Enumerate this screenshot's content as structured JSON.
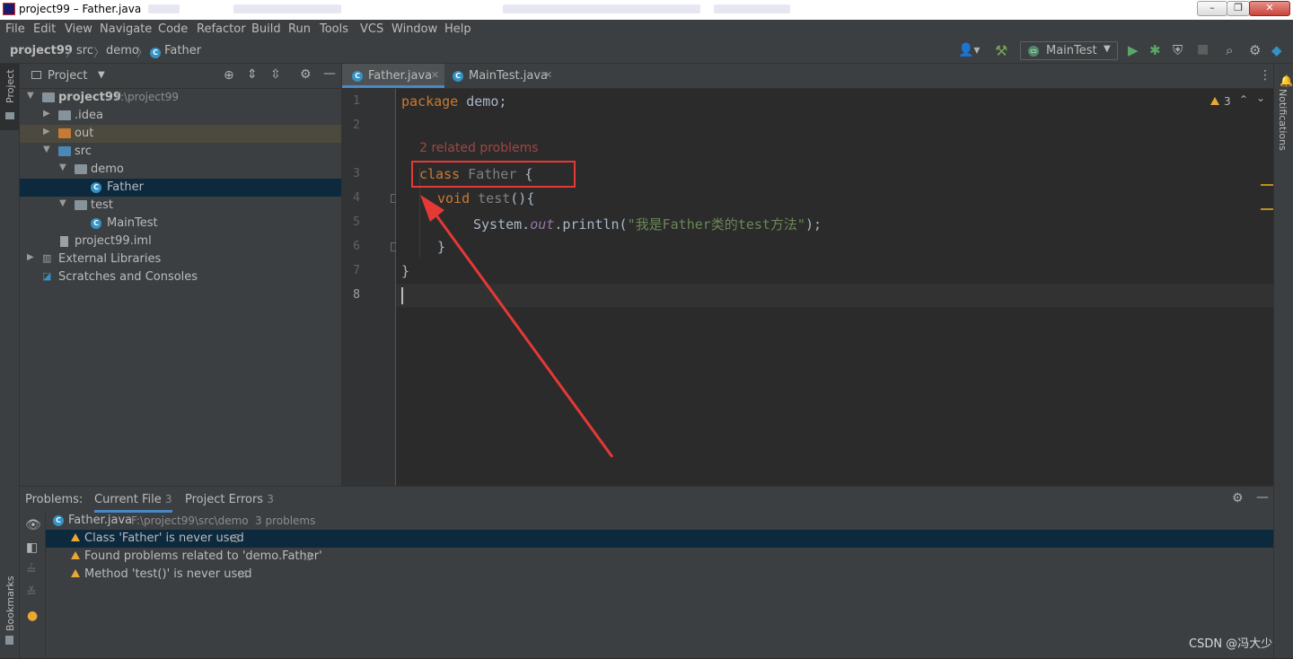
{
  "window": {
    "title": "project99 – Father.java"
  },
  "menu": [
    "File",
    "Edit",
    "View",
    "Navigate",
    "Code",
    "Refactor",
    "Build",
    "Run",
    "Tools",
    "VCS",
    "Window",
    "Help"
  ],
  "breadcrumb": {
    "project": "project99",
    "src": "src",
    "pkg": "demo",
    "file": "Father"
  },
  "run_config": {
    "name": "MainTest"
  },
  "project_panel": {
    "title": "Project",
    "root": {
      "name": "project99",
      "path": "F:\\project99"
    },
    "items": {
      "idea": ".idea",
      "out": "out",
      "src": "src",
      "demo": "demo",
      "father": "Father",
      "test": "test",
      "maintest": "MainTest",
      "iml": "project99.iml",
      "ext": "External Libraries",
      "scratches": "Scratches and Consoles"
    }
  },
  "tabs": [
    {
      "label": "Father.java"
    },
    {
      "label": "MainTest.java"
    }
  ],
  "editor": {
    "warning_count": "3",
    "hint": "2 related problems",
    "line_numbers": [
      "1",
      "2",
      "3",
      "4",
      "5",
      "6",
      "7",
      "8"
    ],
    "code": {
      "l1_kw": "package",
      "l1_rest": " demo;",
      "l3_kw": "class",
      "l3_name": " Father",
      "l3_brace": " {",
      "l4_kw": "void",
      "l4_name": " test",
      "l4_rest": "(){",
      "l5_a": "System.",
      "l5_out": "out",
      "l5_b": ".println(",
      "l5_str": "\"我是Father类的test方法\"",
      "l5_c": ");",
      "l6": "}",
      "l7": "}"
    }
  },
  "side_labels": {
    "project": "Project",
    "notifications": "Notifications",
    "bookmarks": "Bookmarks"
  },
  "problems": {
    "label": "Problems:",
    "tabs": [
      {
        "label": "Current File",
        "count": "3"
      },
      {
        "label": "Project Errors",
        "count": "3"
      }
    ],
    "file": {
      "name": "Father.java",
      "path": "F:\\project99\\src\\demo",
      "summary": "3 problems"
    },
    "rows": [
      {
        "text": "Class 'Father' is never used",
        "line": ":3"
      },
      {
        "text": "Found problems related to 'demo.Father'",
        "line": ":3"
      },
      {
        "text": "Method 'test()' is never used",
        "line": ":4"
      }
    ]
  },
  "watermark": "CSDN @冯大少",
  "colors": {
    "accent": "#4a88c7",
    "annotation": "#e53935",
    "warning": "#e8a833"
  }
}
